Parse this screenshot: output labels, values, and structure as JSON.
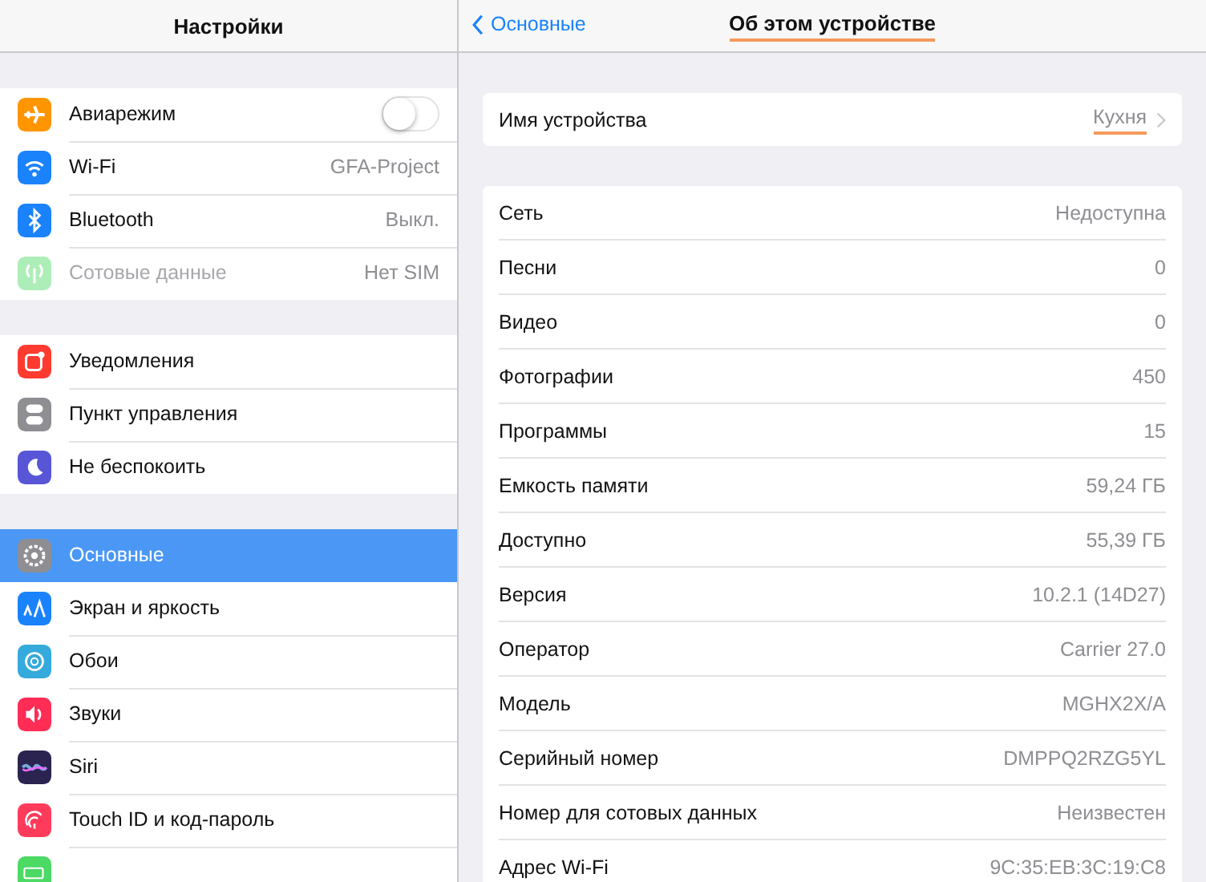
{
  "sidebar": {
    "title": "Настройки",
    "groups": [
      [
        {
          "label": "Авиарежим",
          "kind": "toggle",
          "on": false,
          "selected": false,
          "disabled": false
        },
        {
          "label": "Wi-Fi",
          "kind": "value",
          "value": "GFA-Project",
          "selected": false,
          "disabled": false
        },
        {
          "label": "Bluetooth",
          "kind": "value",
          "value": "Выкл.",
          "selected": false,
          "disabled": false
        },
        {
          "label": "Сотовые данные",
          "kind": "value",
          "value": "Нет SIM",
          "selected": false,
          "disabled": true
        }
      ],
      [
        {
          "label": "Уведомления",
          "kind": "plain",
          "selected": false,
          "disabled": false
        },
        {
          "label": "Пункт управления",
          "kind": "plain",
          "selected": false,
          "disabled": false
        },
        {
          "label": "Не беспокоить",
          "kind": "plain",
          "selected": false,
          "disabled": false
        }
      ],
      [
        {
          "label": "Основные",
          "kind": "plain",
          "selected": true,
          "disabled": false
        },
        {
          "label": "Экран и яркость",
          "kind": "plain",
          "selected": false,
          "disabled": false
        },
        {
          "label": "Обои",
          "kind": "plain",
          "selected": false,
          "disabled": false
        },
        {
          "label": "Звуки",
          "kind": "plain",
          "selected": false,
          "disabled": false
        },
        {
          "label": "Siri",
          "kind": "plain",
          "selected": false,
          "disabled": false
        },
        {
          "label": "Touch ID и код-пароль",
          "kind": "plain",
          "selected": false,
          "disabled": false
        },
        {
          "kind": "plain",
          "selected": false,
          "disabled": false
        }
      ]
    ]
  },
  "detail": {
    "back": "Основные",
    "title": "Об этом устройстве",
    "title_highlighted": true,
    "name_row": {
      "label": "Имя устройства",
      "value": "Кухня",
      "highlighted": true
    },
    "rows": [
      {
        "label": "Сеть",
        "value": "Недоступна"
      },
      {
        "label": "Песни",
        "value": "0"
      },
      {
        "label": "Видео",
        "value": "0"
      },
      {
        "label": "Фотографии",
        "value": "450"
      },
      {
        "label": "Программы",
        "value": "15"
      },
      {
        "label": "Емкость памяти",
        "value": "59,24 ГБ"
      },
      {
        "label": "Доступно",
        "value": "55,39 ГБ"
      },
      {
        "label": "Версия",
        "value": "10.2.1 (14D27)"
      },
      {
        "label": "Оператор",
        "value": "Carrier 27.0"
      },
      {
        "label": "Модель",
        "value": "MGHX2X/A"
      },
      {
        "label": "Серийный номер",
        "value": "DMPPQ2RZG5YL"
      },
      {
        "label": "Номер для сотовых данных",
        "value": "Неизвестен"
      },
      {
        "label": "Адрес Wi-Fi",
        "value": "9C:35:EB:3C:19:C8"
      }
    ]
  }
}
